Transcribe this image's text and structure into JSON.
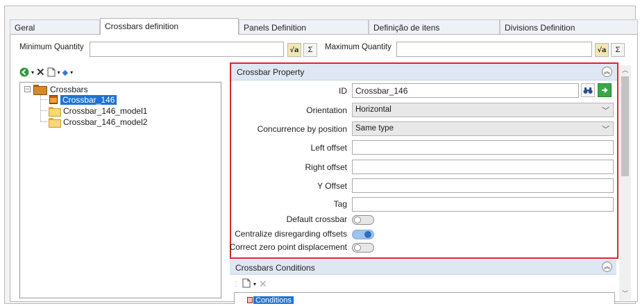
{
  "tabs": [
    {
      "label": "Geral"
    },
    {
      "label": "Crossbars definition"
    },
    {
      "label": "Panels Definition"
    },
    {
      "label": "Definição de itens"
    },
    {
      "label": "Divisions Definition"
    }
  ],
  "quantity": {
    "min_label": "Minimum Quantity",
    "min_value": "",
    "max_label": "Maximum Quantity",
    "max_value": "",
    "sigma_glyph": "Σ",
    "sqrt_glyph": "√a"
  },
  "tree": {
    "root": "Crossbars",
    "children": [
      "Crossbar_146",
      "Crossbar_146_model1",
      "Crossbar_146_model2"
    ],
    "selected_index": 0
  },
  "crossbar_property": {
    "title": "Crossbar Property",
    "id_label": "ID",
    "id_value": "Crossbar_146",
    "orientation_label": "Orientation",
    "orientation_value": "Horizontal",
    "concurrence_label": "Concurrence by position",
    "concurrence_value": "Same type",
    "left_offset_label": "Left offset",
    "left_offset_value": "",
    "right_offset_label": "Right offset",
    "right_offset_value": "",
    "y_offset_label": "Y Offset",
    "y_offset_value": "",
    "tag_label": "Tag",
    "tag_value": "",
    "default_crossbar_label": "Default crossbar",
    "default_crossbar_on": false,
    "centralize_label": "Centralize disregarding offsets",
    "centralize_on": true,
    "correct_zero_label": "Correct zero point displacement",
    "correct_zero_on": false
  },
  "conditions": {
    "title": "Crossbars Conditions",
    "item": "Conditions"
  },
  "icons": [
    "back-icon",
    "delete-icon",
    "new-document-icon",
    "move-down-icon",
    "search-binoculars-icon",
    "go-arrow-icon",
    "collapse-icon",
    "chevron-down-icon"
  ],
  "colors": {
    "highlight_border": "#d7262d",
    "selection": "#1e73d4",
    "panel_header": "#dfe7f3",
    "toggle_on": "#2a6fc0"
  }
}
